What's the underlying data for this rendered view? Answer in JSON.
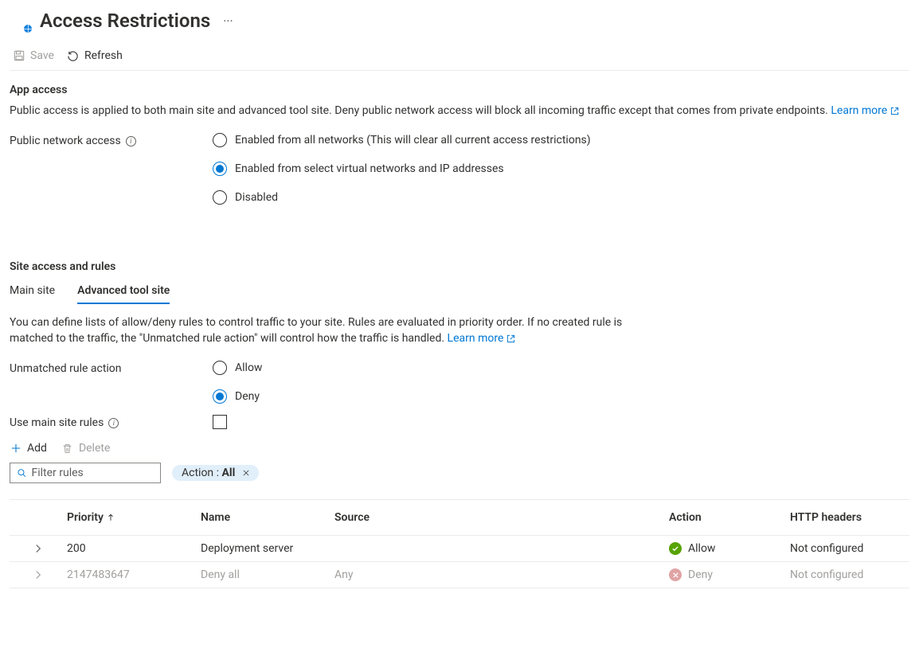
{
  "header": {
    "title": "Access Restrictions"
  },
  "toolbar": {
    "save": "Save",
    "refresh": "Refresh"
  },
  "app_access": {
    "title": "App access",
    "desc": "Public access is applied to both main site and advanced tool site. Deny public network access will block all incoming traffic except that comes from private endpoints.",
    "learn_more": "Learn more",
    "field_label": "Public network access",
    "options": [
      "Enabled from all networks (This will clear all current access restrictions)",
      "Enabled from select virtual networks and IP addresses",
      "Disabled"
    ],
    "selected": 1
  },
  "site_rules": {
    "title": "Site access and rules",
    "tabs": [
      "Main site",
      "Advanced tool site"
    ],
    "active_tab": 1,
    "desc": "You can define lists of allow/deny rules to control traffic to your site. Rules are evaluated in priority order. If no created rule is matched to the traffic, the \"Unmatched rule action\" will control how the traffic is handled.",
    "learn_more": "Learn more",
    "unmatched_label": "Unmatched rule action",
    "unmatched_options": [
      "Allow",
      "Deny"
    ],
    "unmatched_selected": 1,
    "use_main_label": "Use main site rules",
    "use_main_checked": false
  },
  "rules_toolbar": {
    "add": "Add",
    "delete": "Delete"
  },
  "filter": {
    "placeholder": "Filter rules",
    "pill_key": "Action : ",
    "pill_value": "All"
  },
  "table": {
    "columns": {
      "priority": "Priority",
      "name": "Name",
      "source": "Source",
      "action": "Action",
      "http": "HTTP headers"
    },
    "rows": [
      {
        "priority": "200",
        "name": "Deployment server",
        "source": "",
        "action": "Allow",
        "action_kind": "allow",
        "http": "Not configured",
        "dim": false
      },
      {
        "priority": "2147483647",
        "name": "Deny all",
        "source": "Any",
        "action": "Deny",
        "action_kind": "deny",
        "http": "Not configured",
        "dim": true
      }
    ]
  }
}
